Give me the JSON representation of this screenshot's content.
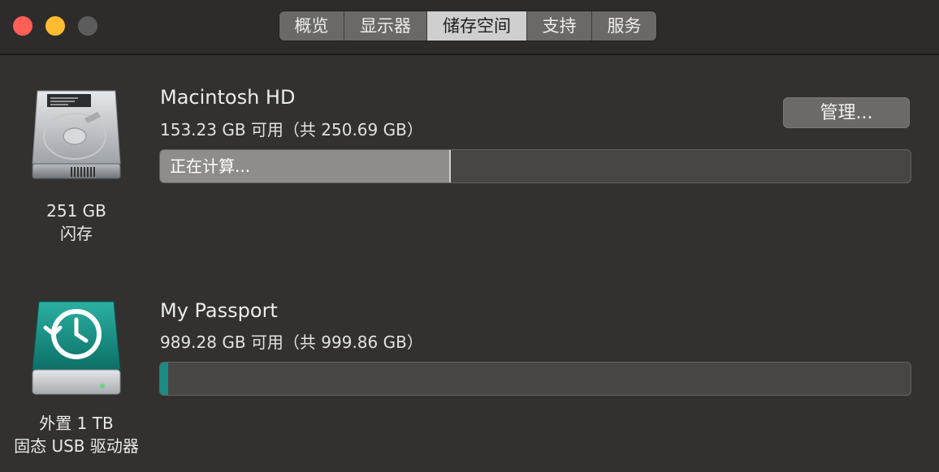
{
  "tabs": [
    {
      "label": "概览"
    },
    {
      "label": "显示器"
    },
    {
      "label": "储存空间",
      "active": true
    },
    {
      "label": "支持"
    },
    {
      "label": "服务"
    }
  ],
  "drives": [
    {
      "name": "Macintosh HD",
      "available": "153.23 GB 可用（共 250.69 GB）",
      "caption_line1": "251 GB",
      "caption_line2": "闪存",
      "bar_label": "正在计算...",
      "usage_fraction": 0.387,
      "icon": "internal-hard-drive-icon",
      "manage_label": "管理..."
    },
    {
      "name": "My Passport",
      "available": "989.28 GB 可用（共 999.86 GB）",
      "caption_line1": "外置 1 TB",
      "caption_line2": "固态 USB 驱动器",
      "usage_fraction": 0.0106,
      "icon": "time-machine-drive-icon"
    }
  ],
  "colors": {
    "background": "#323130",
    "usage_gray": "#8e8d8c",
    "usage_teal": "#1c8d83"
  }
}
